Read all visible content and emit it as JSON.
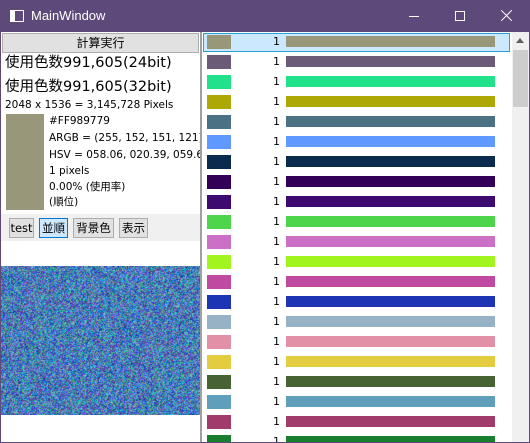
{
  "window": {
    "title": "MainWindow"
  },
  "icons": [
    "app-window-icon",
    "minimize-icon",
    "maximize-icon",
    "close-icon",
    "scroll-up-arrow-icon"
  ],
  "left": {
    "calc_button": "計算実行",
    "color_count_24": "使用色数991,605(24bit)",
    "color_count_32": "使用色数991,605(32bit)",
    "pixels": "2048 x 1536 = 3,145,728 Pixels",
    "selected": {
      "color": "#989779",
      "hex": "#FF989779",
      "argb": "ARGB = (255, 152, 151, 121)",
      "hsv": "HSV = 058.06, 020.39, 059.6",
      "pixels": "1 pixels",
      "usage": "0.00% (使用率)",
      "rank": " (順位)"
    },
    "buttons": [
      {
        "label": "test",
        "active": false
      },
      {
        "label": "並順",
        "active": true
      },
      {
        "label": "背景色",
        "active": false
      },
      {
        "label": "表示",
        "active": false
      }
    ]
  },
  "list": {
    "rows": [
      {
        "color": "#989779",
        "count": "1",
        "selected": true
      },
      {
        "color": "#6c5b78",
        "count": "1"
      },
      {
        "color": "#22e18b",
        "count": "1"
      },
      {
        "color": "#aea806",
        "count": "1"
      },
      {
        "color": "#4b7185",
        "count": "1"
      },
      {
        "color": "#5f99ff",
        "count": "1"
      },
      {
        "color": "#0a2a4e",
        "count": "1"
      },
      {
        "color": "#330057",
        "count": "1"
      },
      {
        "color": "#3d0a6f",
        "count": "1"
      },
      {
        "color": "#4fd54b",
        "count": "1"
      },
      {
        "color": "#cc6fc7",
        "count": "1"
      },
      {
        "color": "#a1f41e",
        "count": "1"
      },
      {
        "color": "#c04aa2",
        "count": "1"
      },
      {
        "color": "#1d35b5",
        "count": "1"
      },
      {
        "color": "#98b2c5",
        "count": "1"
      },
      {
        "color": "#e28fa8",
        "count": "1"
      },
      {
        "color": "#e3cc40",
        "count": "1"
      },
      {
        "color": "#486333",
        "count": "1"
      },
      {
        "color": "#5f9fbc",
        "count": "1"
      },
      {
        "color": "#a13b6c",
        "count": "1"
      },
      {
        "color": "#1a7e2f",
        "count": "1"
      }
    ]
  }
}
